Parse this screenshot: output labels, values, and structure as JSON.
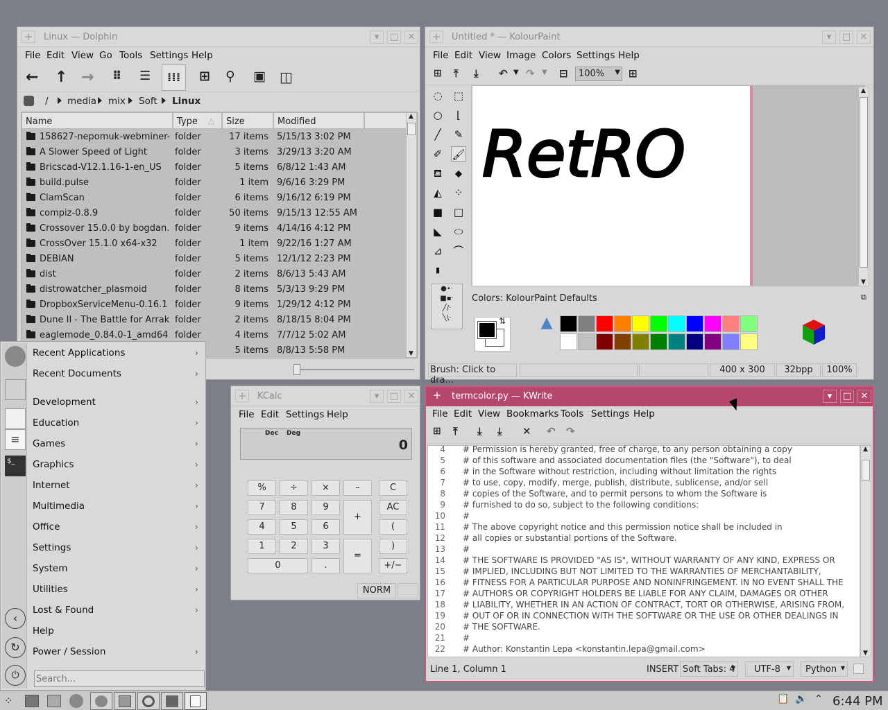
{
  "dolphin": {
    "title": "Linux — Dolphin",
    "menu": [
      "File",
      "Edit",
      "View",
      "Go",
      "Tools",
      "Settings",
      "Help"
    ],
    "breadcrumb": [
      "/",
      "media",
      "mix",
      "Soft",
      "Linux"
    ],
    "columns": [
      "Name",
      "Type",
      "Size",
      "Modified"
    ],
    "rows": [
      {
        "name": "158627-nepomuk-webminer-...",
        "type": "folder",
        "size": "17 items",
        "modified": "5/15/13 3:02 PM"
      },
      {
        "name": "A Slower Speed of Light",
        "type": "folder",
        "size": "3 items",
        "modified": "3/29/13 3:20 AM"
      },
      {
        "name": "Bricscad-V12.1.16-1-en_US",
        "type": "folder",
        "size": "5 items",
        "modified": "6/8/12 1:43 AM"
      },
      {
        "name": "build.pulse",
        "type": "folder",
        "size": "1 item",
        "modified": "9/6/16 3:29 PM"
      },
      {
        "name": "ClamScan",
        "type": "folder",
        "size": "6 items",
        "modified": "9/16/12 6:19 PM"
      },
      {
        "name": "compiz-0.8.9",
        "type": "folder",
        "size": "50 items",
        "modified": "9/15/13 12:55 AM"
      },
      {
        "name": "Crossover 15.0.0 by bogdan.t...",
        "type": "folder",
        "size": "9 items",
        "modified": "4/14/16 4:12 PM"
      },
      {
        "name": "CrossOver 15.1.0 x64-x32",
        "type": "folder",
        "size": "1 item",
        "modified": "9/22/16 1:27 AM"
      },
      {
        "name": "DEBIAN",
        "type": "folder",
        "size": "5 items",
        "modified": "12/1/12 2:23 PM"
      },
      {
        "name": "dist",
        "type": "folder",
        "size": "2 items",
        "modified": "8/6/13 5:43 AM"
      },
      {
        "name": "distrowatcher_plasmoid",
        "type": "folder",
        "size": "8 items",
        "modified": "5/3/13 9:29 PM"
      },
      {
        "name": "DropboxServiceMenu-0.16.1",
        "type": "folder",
        "size": "9 items",
        "modified": "1/29/12 4:12 PM"
      },
      {
        "name": "Dune II - The Battle for Arraki...",
        "type": "folder",
        "size": "2 items",
        "modified": "8/18/15 8:04 PM"
      },
      {
        "name": "eaglemode_0.84.0-1_amd64",
        "type": "folder",
        "size": "4 items",
        "modified": "7/7/12 5:02 AM"
      },
      {
        "name": "",
        "type": "folder",
        "size": "5 items",
        "modified": "8/8/13 5:58 PM"
      }
    ]
  },
  "paint": {
    "title": "Untitled * — KolourPaint",
    "menu": [
      "File",
      "Edit",
      "View",
      "Image",
      "Colors",
      "Settings",
      "Help"
    ],
    "zoom": "100%",
    "canvas_text": "RetRO",
    "colors_label": "Colors: KolourPaint Defaults",
    "palette_top": [
      "#000000",
      "#808080",
      "#ff0000",
      "#ff8000",
      "#ffff00",
      "#00ff00",
      "#00ffff",
      "#0000ff",
      "#ff00ff",
      "#ff8080",
      "#80ff80"
    ],
    "palette_bottom": [
      "#ffffff",
      "#c0c0c0",
      "#800000",
      "#804000",
      "#808000",
      "#008000",
      "#008080",
      "#000080",
      "#800080",
      "#8080ff",
      "#ffff80"
    ],
    "status": {
      "hint": "Brush: Click to dra...",
      "size": "400 x 300",
      "depth": "32bpp",
      "zoom": "100%"
    }
  },
  "calc": {
    "title": "KCalc",
    "menu": [
      "File",
      "Edit",
      "Settings",
      "Help"
    ],
    "display_mode": "Dec",
    "display_angle": "Deg",
    "display_value": "0",
    "keys": [
      "%",
      "÷",
      "×",
      "–",
      "C",
      "7",
      "8",
      "9",
      "+",
      "AC",
      "4",
      "5",
      "6",
      "(",
      "1",
      "2",
      "3",
      "=",
      ")",
      "0",
      ".",
      "+/−"
    ],
    "status": "NORM"
  },
  "kwrite": {
    "title": "termcolor.py — KWrite",
    "menu": [
      "File",
      "Edit",
      "View",
      "Bookmarks",
      "Tools",
      "Settings",
      "Help"
    ],
    "lines": [
      {
        "n": "4",
        "t": "# Permission is hereby granted, free of charge, to any person obtaining a copy"
      },
      {
        "n": "5",
        "t": "# of this software and associated documentation files (the \"Software\"), to deal"
      },
      {
        "n": "6",
        "t": "# in the Software without restriction, including without limitation the rights"
      },
      {
        "n": "7",
        "t": "# to use, copy, modify, merge, publish, distribute, sublicense, and/or sell"
      },
      {
        "n": "8",
        "t": "# copies of the Software, and to permit persons to whom the Software is"
      },
      {
        "n": "9",
        "t": "# furnished to do so, subject to the following conditions:"
      },
      {
        "n": "10",
        "t": "#"
      },
      {
        "n": "11",
        "t": "# The above copyright notice and this permission notice shall be included in"
      },
      {
        "n": "12",
        "t": "# all copies or substantial portions of the Software."
      },
      {
        "n": "13",
        "t": "#"
      },
      {
        "n": "14",
        "t": "# THE SOFTWARE IS PROVIDED \"AS IS\", WITHOUT WARRANTY OF ANY KIND, EXPRESS OR"
      },
      {
        "n": "15",
        "t": "# IMPLIED, INCLUDING BUT NOT LIMITED TO THE WARRANTIES OF MERCHANTABILITY,"
      },
      {
        "n": "16",
        "t": "# FITNESS FOR A PARTICULAR PURPOSE AND NONINFRINGEMENT. IN NO EVENT SHALL THE"
      },
      {
        "n": "17",
        "t": "# AUTHORS OR COPYRIGHT HOLDERS BE LIABLE FOR ANY CLAIM, DAMAGES OR OTHER"
      },
      {
        "n": "18",
        "t": "# LIABILITY, WHETHER IN AN ACTION OF CONTRACT, TORT OR OTHERWISE, ARISING FROM,"
      },
      {
        "n": "19",
        "t": "# OUT OF OR IN CONNECTION WITH THE SOFTWARE OR THE USE OR OTHER DEALINGS IN"
      },
      {
        "n": "20",
        "t": "# THE SOFTWARE."
      },
      {
        "n": "21",
        "t": "#"
      },
      {
        "n": "22",
        "t": "# Author: Konstantin Lepa <konstantin.lepa@gmail.com>"
      }
    ],
    "status": {
      "position": "Line 1, Column 1",
      "mode": "INSERT",
      "tabs": "Soft Tabs: 4",
      "encoding": "UTF-8",
      "syntax": "Python"
    }
  },
  "app_menu": {
    "items": [
      "Recent Applications",
      "Recent Documents",
      "Development",
      "Education",
      "Games",
      "Graphics",
      "Internet",
      "Multimedia",
      "Office",
      "Settings",
      "System",
      "Utilities",
      "Lost & Found",
      "Help",
      "Power / Session"
    ],
    "search_placeholder": "Search..."
  },
  "taskbar": {
    "clock": "6:44 PM"
  },
  "colors": {
    "kwrite_active_title": "#b5476e",
    "accent_border": "#c75b86"
  }
}
